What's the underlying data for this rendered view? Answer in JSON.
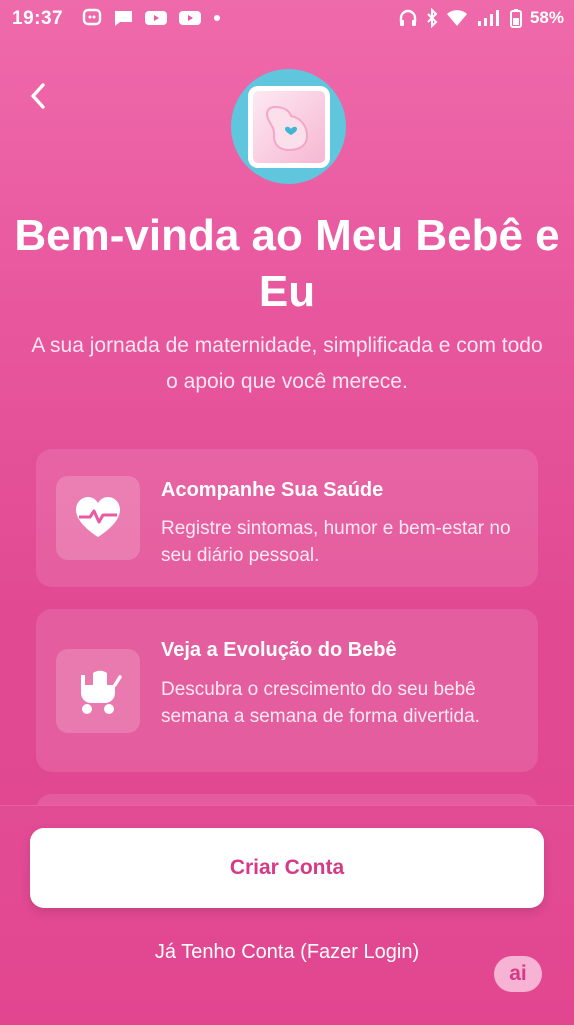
{
  "status_bar": {
    "time": "19:37",
    "battery": "58%",
    "left_icons": [
      "chat-icon",
      "message-icon",
      "video-icon",
      "video-icon",
      "dot-icon"
    ],
    "right_icons": [
      "headphones-icon",
      "bluetooth-icon",
      "wifi-icon",
      "signal-icon",
      "battery-icon"
    ]
  },
  "header": {
    "back_icon": "chevron-left-icon",
    "title": "Bem-vinda ao Meu Bebê e Eu",
    "subtitle": "A sua jornada de maternidade, simplificada e com todo o apoio que você merece."
  },
  "features": [
    {
      "icon": "heart-pulse-icon",
      "title": "Acompanhe Sua Saúde",
      "description": "Registre sintomas, humor e bem-estar no seu diário pessoal."
    },
    {
      "icon": "baby-stroller-icon",
      "title": "Veja a Evolução do Bebê",
      "description": "Descubra o crescimento do seu bebê semana a semana de forma divertida."
    }
  ],
  "actions": {
    "create_account": "Criar Conta",
    "login": "Já Tenho Conta (Fazer Login)"
  },
  "badge": {
    "label": "ai"
  },
  "colors": {
    "background_top": "#ef6aab",
    "background_bottom": "#e0468f",
    "accent": "#d63a86",
    "logo_circle": "#5fc6dd"
  }
}
